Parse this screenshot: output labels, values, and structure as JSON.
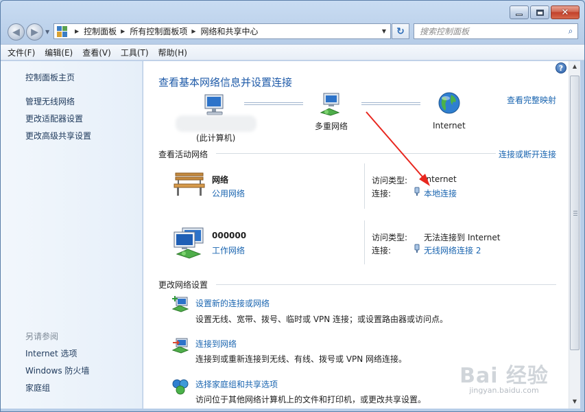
{
  "window": {
    "caption_buttons": [
      "minimize",
      "maximize",
      "close"
    ]
  },
  "address_bar": {
    "breadcrumbs": [
      "控制面板",
      "所有控制面板项",
      "网络和共享中心"
    ],
    "icon": "control-panel-icon"
  },
  "search": {
    "placeholder": "搜索控制面板"
  },
  "menu": [
    "文件(F)",
    "编辑(E)",
    "查看(V)",
    "工具(T)",
    "帮助(H)"
  ],
  "sidebar": {
    "home": "控制面板主页",
    "links": [
      "管理无线网络",
      "更改适配器设置",
      "更改高级共享设置"
    ],
    "see_also_title": "另请参阅",
    "see_also": [
      "Internet 选项",
      "Windows 防火墙",
      "家庭组"
    ]
  },
  "main": {
    "title": "查看基本网络信息并设置连接",
    "full_map_link": "查看完整映射",
    "map": {
      "computer": "(此计算机)",
      "multi": "多重网络",
      "internet": "Internet"
    },
    "active_title": "查看活动网络",
    "connect_link": "连接或断开连接",
    "networks": [
      {
        "name": "网络",
        "type": "公用网络",
        "access_label": "访问类型:",
        "access_value": "Internet",
        "conn_label": "连接:",
        "conn_value": "本地连接"
      },
      {
        "name": "000000",
        "type": "工作网络",
        "access_label": "访问类型:",
        "access_value": "无法连接到 Internet",
        "conn_label": "连接:",
        "conn_value": "无线网络连接 2"
      }
    ],
    "change_title": "更改网络设置",
    "tasks": [
      {
        "title": "设置新的连接或网络",
        "desc": "设置无线、宽带、拨号、临时或 VPN 连接；或设置路由器或访问点。"
      },
      {
        "title": "连接到网络",
        "desc": "连接到或重新连接到无线、有线、拨号或 VPN 网络连接。"
      },
      {
        "title": "选择家庭组和共享选项",
        "desc": "访问位于其他网络计算机上的文件和打印机，或更改共享设置。"
      }
    ]
  },
  "watermark": {
    "mark": "Bai 经验",
    "url": "jingyan.baidu.com"
  },
  "colors": {
    "link": "#1a65b0",
    "title": "#1e5aa8",
    "arrow": "#e8271f"
  }
}
